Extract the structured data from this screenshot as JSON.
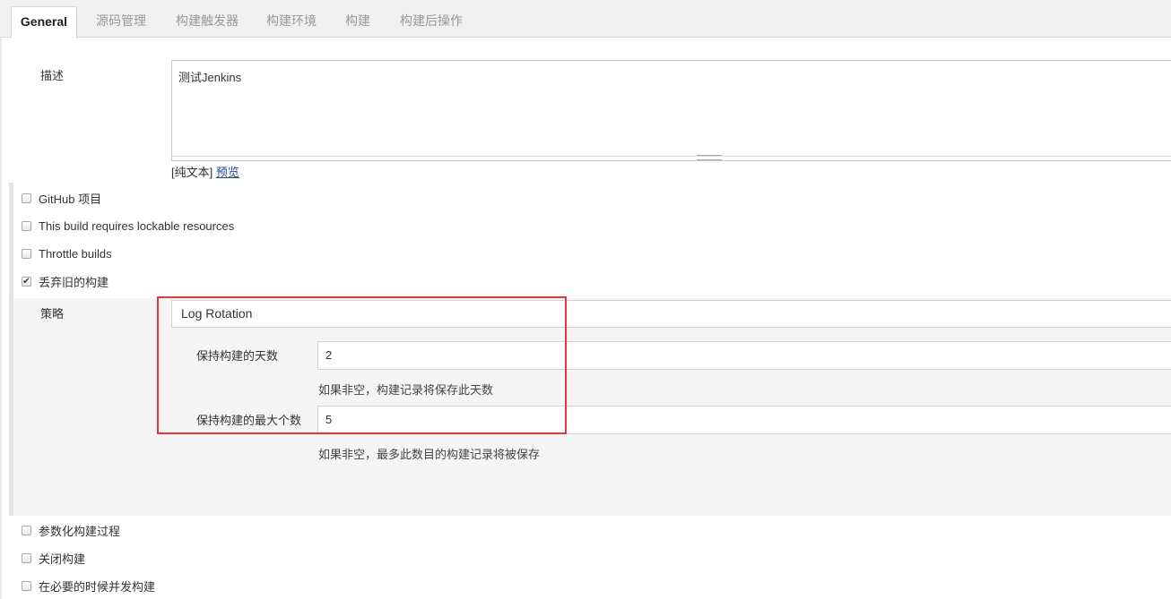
{
  "tabs": [
    "General",
    "源码管理",
    "构建触发器",
    "构建环境",
    "构建",
    "构建后操作"
  ],
  "description": {
    "label": "描述",
    "value": "测试Jenkins",
    "plain_text": "[纯文本]",
    "preview": "预览"
  },
  "options": [
    {
      "label": "GitHub 项目",
      "checked": false
    },
    {
      "label": "This build requires lockable resources",
      "checked": false
    },
    {
      "label": "Throttle builds",
      "checked": false
    },
    {
      "label": "丢弃旧的构建",
      "checked": true
    }
  ],
  "discard": {
    "strategy_label": "策略",
    "strategy_value": "Log Rotation",
    "days_label": "保持构建的天数",
    "days_value": "2",
    "days_hint": "如果非空，构建记录将保存此天数",
    "max_label": "保持构建的最大个数",
    "max_value": "5",
    "max_hint": "如果非空，最多此数目的构建记录将被保存"
  },
  "more_options": [
    {
      "label": "参数化构建过程",
      "checked": false
    },
    {
      "label": "关闭构建",
      "checked": false
    },
    {
      "label": "在必要的时候并发构建",
      "checked": false
    }
  ],
  "colors": {
    "highlight": "#e8353a",
    "link": "#204a87"
  }
}
